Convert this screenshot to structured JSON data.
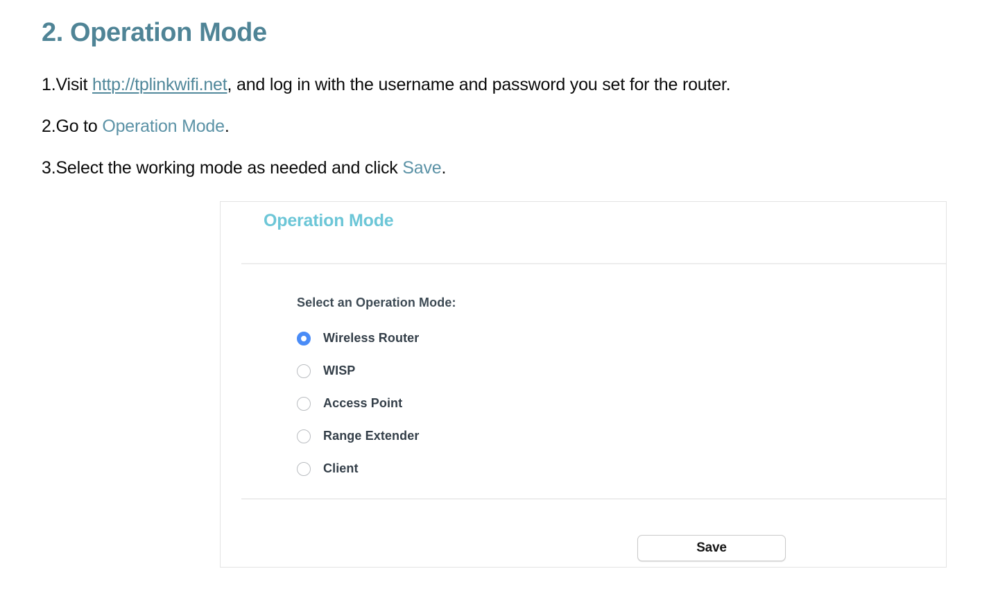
{
  "document": {
    "title": "2. Operation Mode",
    "steps": [
      {
        "number": "1.",
        "text_before": "Visit ",
        "link": "http://tplinkwifi.net",
        "text_after": ", and log in with the username and password you set for the router."
      },
      {
        "number": "2.",
        "text_before": "Go to ",
        "accent": "Operation Mode",
        "text_after": "."
      },
      {
        "number": "3.",
        "text_before": "Select the working mode as needed and click ",
        "accent": "Save",
        "text_after": "."
      }
    ]
  },
  "panel": {
    "title": "Operation Mode",
    "form_label": "Select an Operation Mode:",
    "options": [
      {
        "label": "Wireless Router",
        "selected": true
      },
      {
        "label": "WISP",
        "selected": false
      },
      {
        "label": "Access Point",
        "selected": false
      },
      {
        "label": "Range Extender",
        "selected": false
      },
      {
        "label": "Client",
        "selected": false
      }
    ],
    "save_label": "Save"
  },
  "colors": {
    "heading": "#4f8496",
    "link": "#50879a",
    "accent": "#5b92a6",
    "panel_title": "#6cc6d7",
    "radio_selected": "#4a8cf7",
    "panel_border": "#e3e3e3",
    "divider": "#ededed"
  }
}
